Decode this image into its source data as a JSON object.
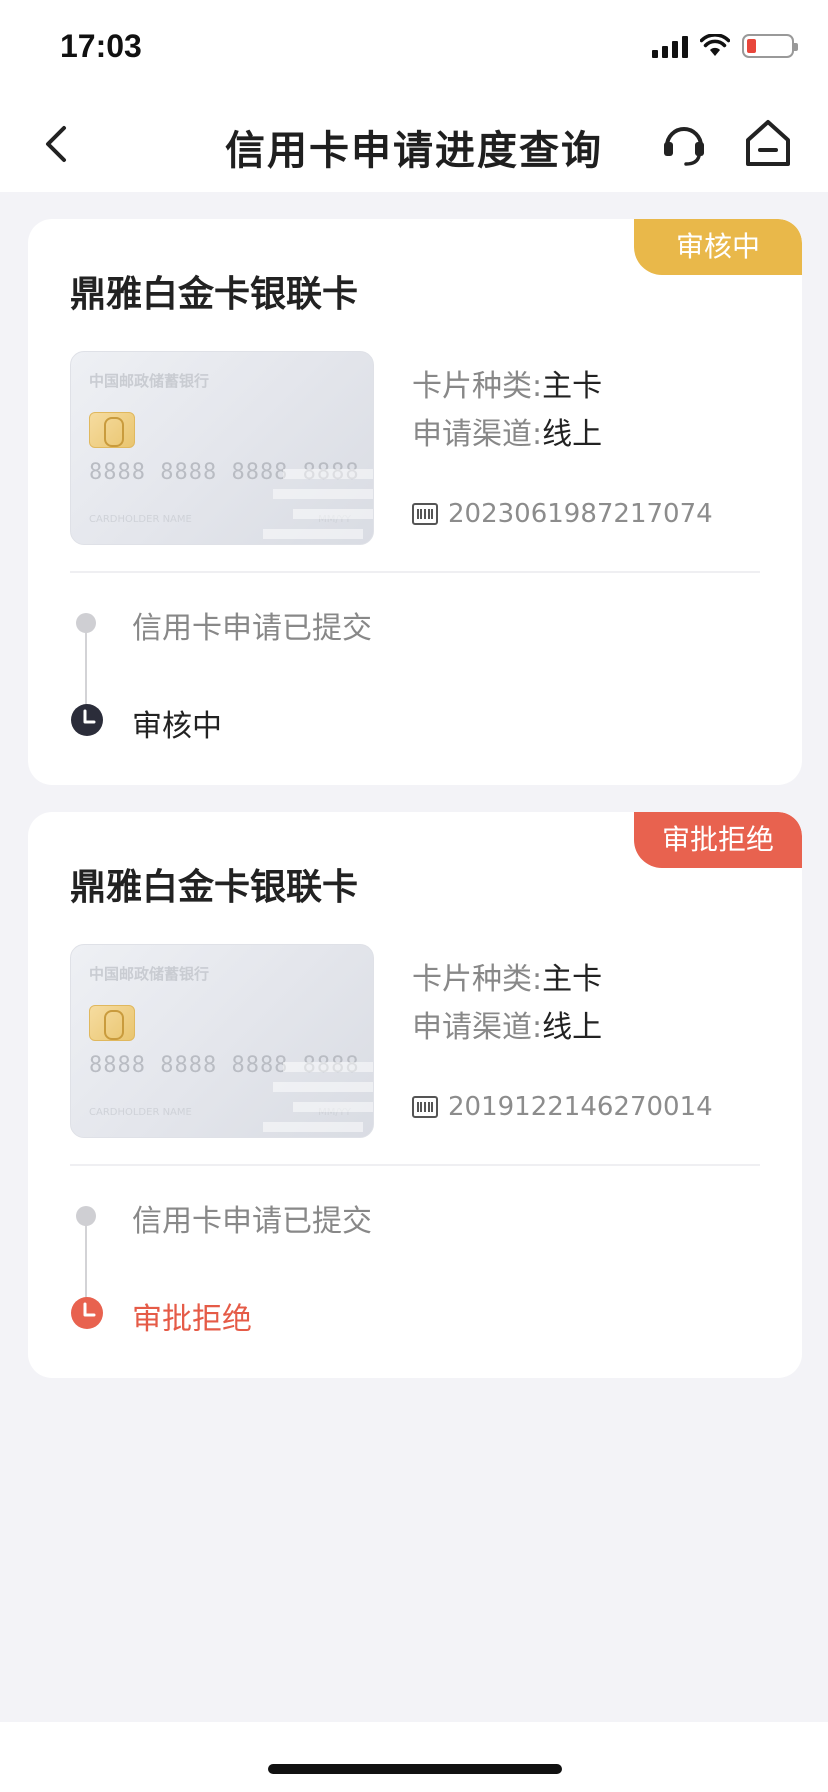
{
  "status_bar": {
    "time": "17:03"
  },
  "nav": {
    "title": "信用卡申请进度查询"
  },
  "applications": [
    {
      "status_tag": "审核中",
      "status_color": "#e9b84a",
      "card_name": "鼎雅白金卡银联卡",
      "card_image": {
        "bank_name": "中国邮政储蓄银行",
        "number": "8888 8888 8888 8888",
        "holder": "CARDHOLDER NAME",
        "valid": "MM/YY"
      },
      "card_type_label": "卡片种类:",
      "card_type_value": "主卡",
      "channel_label": "申请渠道:",
      "channel_value": "线上",
      "application_number": "2023061987217074",
      "timeline": [
        {
          "text": "信用卡申请已提交"
        },
        {
          "text": "审核中"
        }
      ]
    },
    {
      "status_tag": "审批拒绝",
      "status_color": "#e8624f",
      "card_name": "鼎雅白金卡银联卡",
      "card_image": {
        "bank_name": "中国邮政储蓄银行",
        "number": "8888 8888 8888 8888",
        "holder": "CARDHOLDER NAME",
        "valid": "MM/YY"
      },
      "card_type_label": "卡片种类:",
      "card_type_value": "主卡",
      "channel_label": "申请渠道:",
      "channel_value": "线上",
      "application_number": "2019122146270014",
      "timeline": [
        {
          "text": "信用卡申请已提交"
        },
        {
          "text": "审批拒绝"
        }
      ]
    }
  ]
}
